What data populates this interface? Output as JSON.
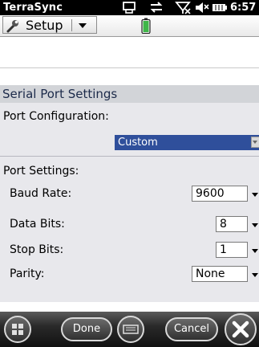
{
  "status_bar": {
    "app_title": "TerraSync",
    "time": "6:57",
    "icons": [
      "sync-icon",
      "network-icon",
      "signal-icon",
      "volume-icon",
      "battery-icon"
    ]
  },
  "toolbar": {
    "section_label": "Setup",
    "icons": [
      "wrench-icon",
      "chevron-down-icon",
      "battery-level-icon"
    ]
  },
  "section": {
    "title": "Serial Port Settings",
    "port_configuration_label": "Port Configuration:",
    "port_configuration_value": "Custom",
    "port_settings_label": "Port Settings:",
    "fields": [
      {
        "label": "Baud Rate:",
        "value": "9600"
      },
      {
        "label": "Data Bits:",
        "value": "8"
      },
      {
        "label": "Stop Bits:",
        "value": "1"
      },
      {
        "label": "Parity:",
        "value": "None"
      }
    ]
  },
  "bottom_bar": {
    "done_label": "Done",
    "cancel_label": "Cancel",
    "icons": [
      "windows-start-icon",
      "keyboard-icon",
      "close-icon"
    ]
  },
  "colors": {
    "highlight_select": "#2f4f9b",
    "section_header_bg": "#d2d4d8",
    "content_bg": "#e8e8ec",
    "status_bar_bg": "#000000"
  }
}
